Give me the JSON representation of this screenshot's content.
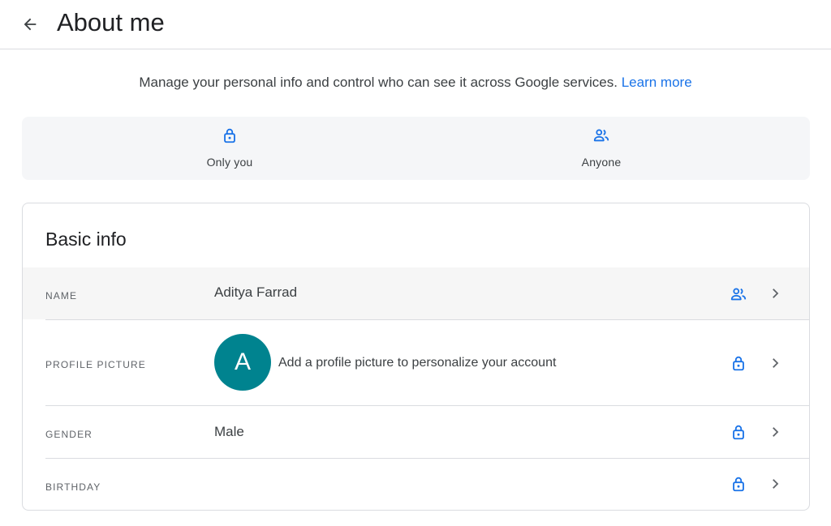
{
  "header": {
    "back_icon": "arrow-back-icon",
    "title": "About me"
  },
  "intro": {
    "text": "Manage your personal info and control who can see it across Google services.",
    "link": "Learn more"
  },
  "legend": {
    "only_you": {
      "icon": "lock-icon",
      "label": "Only you"
    },
    "anyone": {
      "icon": "people-icon",
      "label": "Anyone"
    }
  },
  "basic_info": {
    "title": "Basic info",
    "rows": [
      {
        "label": "NAME",
        "value": "Aditya Farrad",
        "visibility": "people-icon"
      },
      {
        "label": "PROFILE PICTURE",
        "avatar_letter": "A",
        "value": "Add a profile picture to personalize your account",
        "visibility": "lock-icon"
      },
      {
        "label": "GENDER",
        "value": "Male",
        "visibility": "lock-icon"
      },
      {
        "label": "BIRTHDAY",
        "value": "",
        "visibility": "lock-icon"
      }
    ]
  },
  "colors": {
    "accent": "#1a73e8",
    "avatar_bg": "#00838f",
    "divider": "#dadce0"
  }
}
